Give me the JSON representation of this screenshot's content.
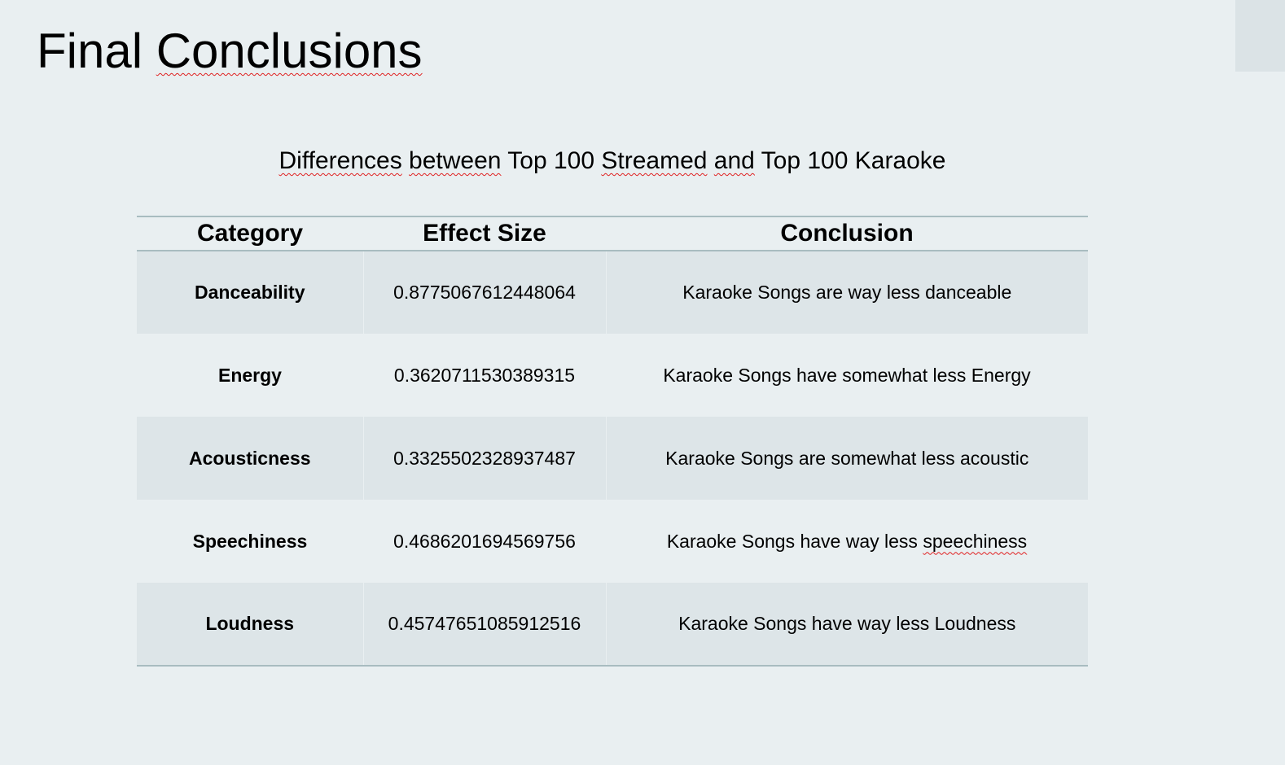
{
  "slide": {
    "title": {
      "plain": "Final ",
      "flagged": "Conclusions"
    },
    "caption": {
      "w1": "Differences",
      "s1": " ",
      "w2": "between",
      "s2": " Top 100 ",
      "w3": "Streamed",
      "s3": " ",
      "w4": "and",
      "s4": " Top 100 Karaoke"
    }
  },
  "table": {
    "headers": [
      "Category",
      "Effect Size",
      "Conclusion"
    ],
    "rows": [
      {
        "category": "Danceability",
        "effect_size": "0.8775067612448064",
        "conclusion": "Karaoke Songs are way less danceable",
        "conclusion_flagged": ""
      },
      {
        "category": "Energy",
        "effect_size": "0.3620711530389315",
        "conclusion": "Karaoke Songs have somewhat less Energy",
        "conclusion_flagged": ""
      },
      {
        "category": "Acousticness",
        "effect_size": "0.3325502328937487",
        "conclusion": "Karaoke Songs are somewhat less acoustic",
        "conclusion_flagged": ""
      },
      {
        "category": "Speechiness",
        "effect_size": "0.4686201694569756",
        "conclusion": "Karaoke Songs have way less ",
        "conclusion_flagged": "speechiness"
      },
      {
        "category": "Loudness",
        "effect_size": "0.45747651085912516",
        "conclusion": "Karaoke Songs have way less Loudness",
        "conclusion_flagged": ""
      }
    ]
  },
  "colors": {
    "background": "#e9eff1",
    "banded_row": "#dde5e8",
    "rule": "#a8bcc0",
    "spellcheck": "#e02020"
  }
}
